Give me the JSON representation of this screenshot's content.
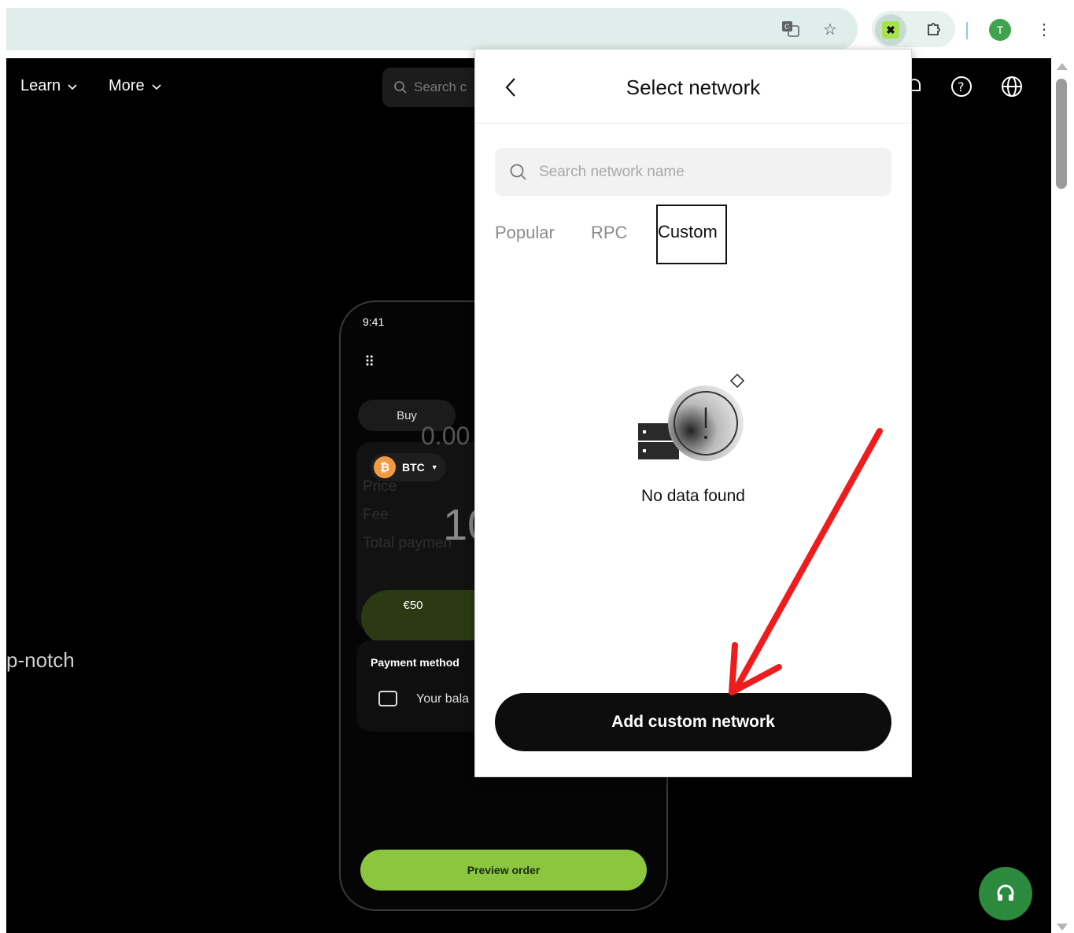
{
  "browser": {
    "avatar_letter": "T",
    "extension_badge": "✖"
  },
  "page": {
    "nav": {
      "learn_label": "Learn",
      "more_label": "More",
      "search_placeholder": "Search c"
    },
    "hero_text": "p-notch",
    "phone": {
      "time": "9:41",
      "buy_tab": "Buy",
      "amount": "0.00",
      "coin": "BTC",
      "price_label": "Price",
      "fee_label": "Fee",
      "total_label": "Total paymen",
      "big_number": "10",
      "preset_amount": "€50",
      "payment_method_title": "Payment method",
      "balance_label": "Your bala",
      "preview_button": "Preview order"
    }
  },
  "popup": {
    "title": "Select network",
    "search_placeholder": "Search network name",
    "tabs": [
      {
        "label": "Popular",
        "active": false
      },
      {
        "label": "RPC",
        "active": false
      },
      {
        "label": "Custom",
        "active": true
      }
    ],
    "empty_text": "No data found",
    "add_button": "Add custom network"
  },
  "colors": {
    "annotation_arrow": "#ee1c1c",
    "accent_green": "#8cc63f",
    "support_green": "#2b8a3e"
  }
}
